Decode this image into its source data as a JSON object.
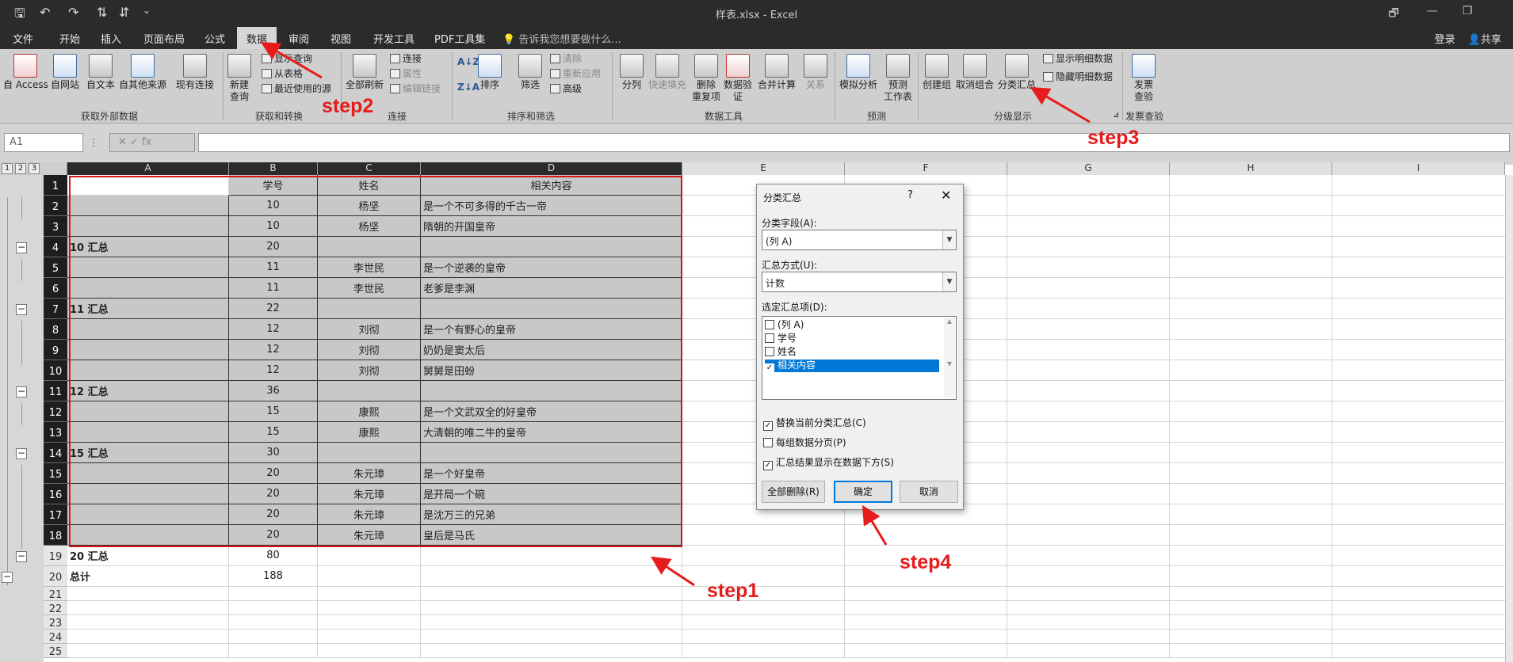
{
  "titlebar": {
    "title": "样表.xlsx - Excel",
    "qa_save": "🖫",
    "qa_undo": "↶",
    "qa_redo": "↷",
    "qa_sort_asc": "⇅",
    "qa_sort_desc": "⇵",
    "qa_more": "⌄",
    "wc_min": "🗗",
    "wc_restore": "—",
    "wc_max": "❐"
  },
  "tabs": {
    "file": "文件",
    "home": "开始",
    "insert": "插入",
    "layout": "页面布局",
    "formulas": "公式",
    "data": "数据",
    "review": "审阅",
    "view": "视图",
    "developer": "开发工具",
    "pdf": "PDF工具集",
    "tellme": "告诉我您想要做什么...",
    "login": "登录",
    "share": "共享"
  },
  "ribbon": {
    "from_access": "自 Access",
    "from_web": "自网站",
    "from_text": "自文本",
    "from_other": "自其他来源",
    "existing_conn": "现有连接",
    "new_query_1": "新建",
    "new_query_2": "查询",
    "show_query": "显示查询",
    "from_table": "从表格",
    "recent_sources": "最近使用的源",
    "refresh_all": "全部刷新",
    "connections": "连接",
    "properties": "属性",
    "edit_links": "编辑链接",
    "sort": "排序",
    "filter": "筛选",
    "clear": "清除",
    "reapply": "重新应用",
    "advanced": "高级",
    "text_to_col": "分列",
    "flash_fill": "快速填充",
    "remove_dup_1": "删除",
    "remove_dup_2": "重复项",
    "validation_1": "数据验",
    "validation_2": "证",
    "consolidate": "合并计算",
    "relations": "关系",
    "whatif": "模拟分析",
    "forecast_1": "预测",
    "forecast_2": "工作表",
    "group": "创建组",
    "ungroup": "取消组合",
    "subtotal": "分类汇总",
    "show_detail": "显示明细数据",
    "hide_detail": "隐藏明细数据",
    "invoice_1": "发票",
    "invoice_2": "查验",
    "grp_external": "获取外部数据",
    "grp_transform": "获取和转换",
    "grp_connections": "连接",
    "grp_sort": "排序和筛选",
    "grp_tools": "数据工具",
    "grp_forecast": "预测",
    "grp_outline": "分级显示",
    "grp_invoice": "发票查验"
  },
  "formula_bar": {
    "name_box": "A1",
    "buttons": "✕   ✓   fx",
    "formula": ""
  },
  "outline_levels": [
    "1",
    "2",
    "3"
  ],
  "columns": [
    "A",
    "B",
    "C",
    "D",
    "E",
    "F",
    "G",
    "H",
    "I"
  ],
  "rows": [
    {
      "n": "1",
      "a": "",
      "b": "学号",
      "c": "姓名",
      "d": "相关内容"
    },
    {
      "n": "2",
      "a": "",
      "b": "10",
      "c": "杨坚",
      "d": "是一个不可多得的千古一帝"
    },
    {
      "n": "3",
      "a": "",
      "b": "10",
      "c": "杨坚",
      "d": "隋朝的开国皇帝"
    },
    {
      "n": "4",
      "a": "10 汇总",
      "b": "20",
      "c": "",
      "d": ""
    },
    {
      "n": "5",
      "a": "",
      "b": "11",
      "c": "李世民",
      "d": "是一个逆袭的皇帝"
    },
    {
      "n": "6",
      "a": "",
      "b": "11",
      "c": "李世民",
      "d": "老爹是李渊"
    },
    {
      "n": "7",
      "a": "11 汇总",
      "b": "22",
      "c": "",
      "d": ""
    },
    {
      "n": "8",
      "a": "",
      "b": "12",
      "c": "刘彻",
      "d": "是一个有野心的皇帝"
    },
    {
      "n": "9",
      "a": "",
      "b": "12",
      "c": "刘彻",
      "d": "奶奶是窦太后"
    },
    {
      "n": "10",
      "a": "",
      "b": "12",
      "c": "刘彻",
      "d": "舅舅是田蚡"
    },
    {
      "n": "11",
      "a": "12 汇总",
      "b": "36",
      "c": "",
      "d": ""
    },
    {
      "n": "12",
      "a": "",
      "b": "15",
      "c": "康熙",
      "d": "是一个文武双全的好皇帝"
    },
    {
      "n": "13",
      "a": "",
      "b": "15",
      "c": "康熙",
      "d": "大清朝的唯二牛的皇帝"
    },
    {
      "n": "14",
      "a": "15 汇总",
      "b": "30",
      "c": "",
      "d": ""
    },
    {
      "n": "15",
      "a": "",
      "b": "20",
      "c": "朱元璋",
      "d": "是一个好皇帝"
    },
    {
      "n": "16",
      "a": "",
      "b": "20",
      "c": "朱元璋",
      "d": "是开局一个碗"
    },
    {
      "n": "17",
      "a": "",
      "b": "20",
      "c": "朱元璋",
      "d": "是沈万三的兄弟"
    },
    {
      "n": "18",
      "a": "",
      "b": "20",
      "c": "朱元璋",
      "d": "皇后是马氏"
    },
    {
      "n": "19",
      "a": "20 汇总",
      "b": "80",
      "c": "",
      "d": ""
    },
    {
      "n": "20",
      "a": "总计",
      "b": "188",
      "c": "",
      "d": ""
    },
    {
      "n": "21",
      "a": "",
      "b": "",
      "c": "",
      "d": ""
    },
    {
      "n": "22",
      "a": "",
      "b": "",
      "c": "",
      "d": ""
    },
    {
      "n": "23",
      "a": "",
      "b": "",
      "c": "",
      "d": ""
    },
    {
      "n": "24",
      "a": "",
      "b": "",
      "c": "",
      "d": ""
    },
    {
      "n": "25",
      "a": "",
      "b": "",
      "c": "",
      "d": ""
    }
  ],
  "dialog": {
    "title": "分类汇总",
    "help": "?",
    "close": "✕",
    "field_label": "分类字段(A):",
    "field_value": "(列 A)",
    "func_label": "汇总方式(U):",
    "func_value": "计数",
    "items_label": "选定汇总项(D):",
    "items": [
      {
        "label": "(列 A)",
        "checked": false,
        "selected": false
      },
      {
        "label": "学号",
        "checked": false,
        "selected": false
      },
      {
        "label": "姓名",
        "checked": false,
        "selected": false
      },
      {
        "label": "相关内容",
        "checked": true,
        "selected": true
      }
    ],
    "opt_replace": "替换当前分类汇总(C)",
    "opt_pagebreak": "每组数据分页(P)",
    "opt_below": "汇总结果显示在数据下方(S)",
    "opt_replace_checked": true,
    "opt_pagebreak_checked": false,
    "opt_below_checked": true,
    "btn_remove_all": "全部删除(R)",
    "btn_ok": "确定",
    "btn_cancel": "取消"
  },
  "annotations": {
    "step1": "step1",
    "step2": "step2",
    "step3": "step3",
    "step4": "step4"
  },
  "colors": {
    "annotation_red": "#e61b1b",
    "selection_blue": "#0078d7",
    "dark_chrome": "#2b2b2b"
  }
}
